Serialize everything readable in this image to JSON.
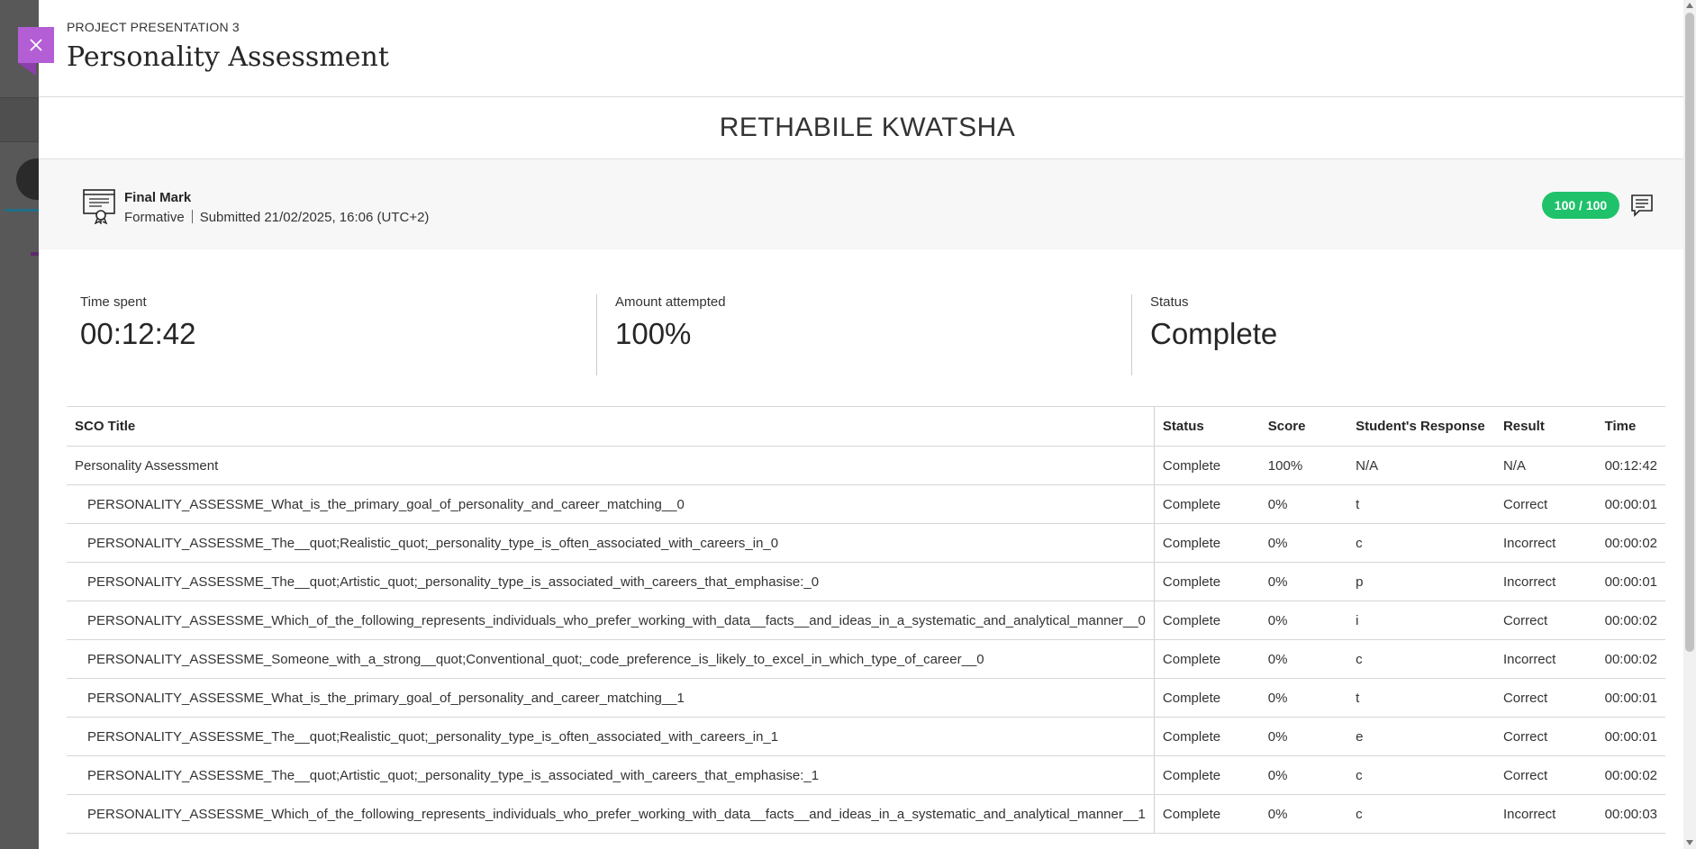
{
  "header": {
    "breadcrumb": "PROJECT PRESENTATION 3",
    "title": "Personality Assessment"
  },
  "close_icon": "close-icon",
  "student": {
    "name": "RETHABILE KWATSHA"
  },
  "grade": {
    "icon": "certificate-icon",
    "title": "Final Mark",
    "type": "Formative",
    "submitted": "Submitted 21/02/2025, 16:06 (UTC+2)",
    "score": "100 / 100",
    "score_color": "#1fc26a",
    "feedback_icon": "feedback-icon"
  },
  "stats": {
    "time_spent": {
      "label": "Time spent",
      "value": "00:12:42"
    },
    "amount_attempted": {
      "label": "Amount attempted",
      "value": "100%"
    },
    "status": {
      "label": "Status",
      "value": "Complete"
    }
  },
  "table": {
    "headers": [
      "SCO Title",
      "Status",
      "Score",
      "Student's Response",
      "Result",
      "Time"
    ],
    "rows": [
      {
        "title": "Personality Assessment",
        "status": "Complete",
        "score": "100%",
        "response": "N/A",
        "result": "N/A",
        "time": "00:12:42"
      },
      {
        "title": "PERSONALITY_ASSESSME_What_is_the_primary_goal_of_personality_and_career_matching__0",
        "status": "Complete",
        "score": "0%",
        "response": "t",
        "result": "Correct",
        "time": "00:00:01"
      },
      {
        "title": "PERSONALITY_ASSESSME_The__quot;Realistic_quot;_personality_type_is_often_associated_with_careers_in_0",
        "status": "Complete",
        "score": "0%",
        "response": "c",
        "result": "Incorrect",
        "time": "00:00:02"
      },
      {
        "title": "PERSONALITY_ASSESSME_The__quot;Artistic_quot;_personality_type_is_associated_with_careers_that_emphasise:_0",
        "status": "Complete",
        "score": "0%",
        "response": "p",
        "result": "Incorrect",
        "time": "00:00:01"
      },
      {
        "title": "PERSONALITY_ASSESSME_Which_of_the_following_represents_individuals_who_prefer_working_with_data__facts__and_ideas_in_a_systematic_and_analytical_manner__0",
        "status": "Complete",
        "score": "0%",
        "response": "i",
        "result": "Correct",
        "time": "00:00:02"
      },
      {
        "title": "PERSONALITY_ASSESSME_Someone_with_a_strong__quot;Conventional_quot;_code_preference_is_likely_to_excel_in_which_type_of_career__0",
        "status": "Complete",
        "score": "0%",
        "response": "c",
        "result": "Incorrect",
        "time": "00:00:02"
      },
      {
        "title": "PERSONALITY_ASSESSME_What_is_the_primary_goal_of_personality_and_career_matching__1",
        "status": "Complete",
        "score": "0%",
        "response": "t",
        "result": "Correct",
        "time": "00:00:01"
      },
      {
        "title": "PERSONALITY_ASSESSME_The__quot;Realistic_quot;_personality_type_is_often_associated_with_careers_in_1",
        "status": "Complete",
        "score": "0%",
        "response": "e",
        "result": "Correct",
        "time": "00:00:01"
      },
      {
        "title": "PERSONALITY_ASSESSME_The__quot;Artistic_quot;_personality_type_is_associated_with_careers_that_emphasise:_1",
        "status": "Complete",
        "score": "0%",
        "response": "c",
        "result": "Correct",
        "time": "00:00:02"
      },
      {
        "title": "PERSONALITY_ASSESSME_Which_of_the_following_represents_individuals_who_prefer_working_with_data__facts__and_ideas_in_a_systematic_and_analytical_manner__1",
        "status": "Complete",
        "score": "0%",
        "response": "c",
        "result": "Incorrect",
        "time": "00:00:03"
      }
    ]
  },
  "accent_color": "#b45ed6"
}
